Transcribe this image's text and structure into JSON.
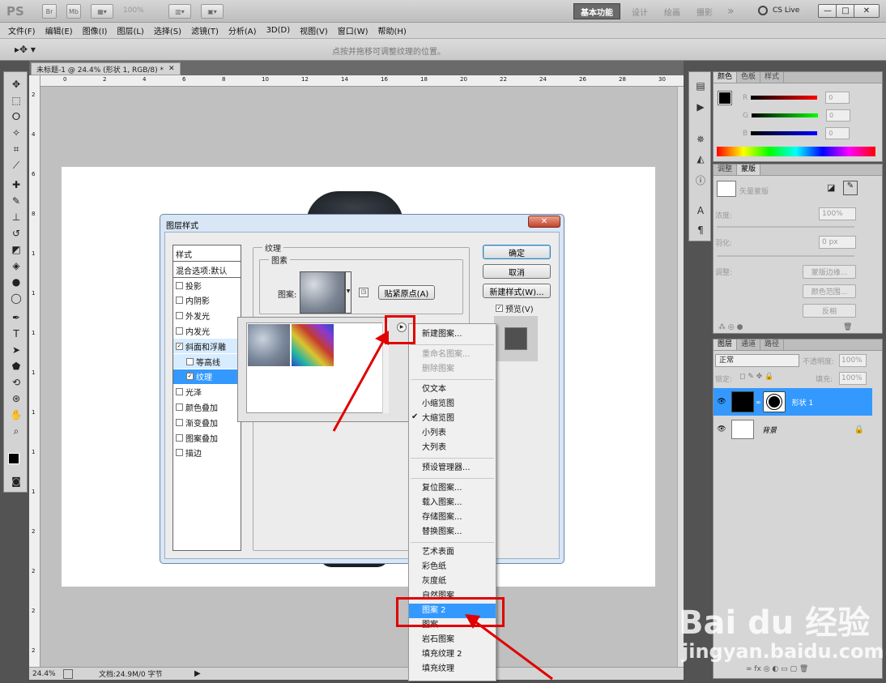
{
  "appbar": {
    "logo": "PS",
    "zoom": "100%",
    "workspaces": [
      "基本功能",
      "设计",
      "绘画",
      "摄影"
    ],
    "more": "»",
    "cslive": "CS Live",
    "min": "—",
    "restore": "□",
    "close": "✕"
  },
  "menubar": {
    "items": [
      "文件(F)",
      "编辑(E)",
      "图像(I)",
      "图层(L)",
      "选择(S)",
      "滤镜(T)",
      "分析(A)",
      "3D(D)",
      "视图(V)",
      "窗口(W)",
      "帮助(H)"
    ]
  },
  "optionsbar": {
    "hint": "点按并拖移可调整纹理的位置。"
  },
  "document": {
    "tab_title": "未标题-1 @ 24.4% (形状 1, RGB/8) *",
    "tab_close": "✕",
    "ruler_h": [
      "0",
      "2",
      "4",
      "6",
      "8",
      "10",
      "12",
      "14",
      "16",
      "18",
      "20",
      "22",
      "24",
      "26",
      "28",
      "30"
    ],
    "ruler_v": [
      "2",
      "4",
      "6",
      "8",
      "1",
      "1",
      "1",
      "1",
      "1",
      "1",
      "1",
      "2",
      "2",
      "2",
      "2"
    ]
  },
  "statusbar": {
    "zoom": "24.4%",
    "doc": "文档:24.9M/0 字节"
  },
  "color_panel": {
    "tabs": [
      "颜色",
      "色板",
      "样式"
    ],
    "labels": [
      "R",
      "G",
      "B"
    ],
    "values": [
      "0",
      "0",
      "0"
    ]
  },
  "mask_panel": {
    "tabs": [
      "调整",
      "蒙版"
    ],
    "title": "矢量蒙版",
    "density_label": "浓度:",
    "density": "100%",
    "feather_label": "羽化:",
    "feather": "0 px",
    "refine_label": "调整:",
    "buttons": [
      "蒙版边缘...",
      "颜色范围...",
      "反相"
    ]
  },
  "layers_panel": {
    "tabs": [
      "图层",
      "通道",
      "路径"
    ],
    "blend_mode": "正常",
    "opacity_label": "不透明度:",
    "opacity": "100%",
    "lock_label": "锁定:",
    "fill_label": "填充:",
    "fill": "100%",
    "layers": [
      {
        "name": "形状 1",
        "selected": true
      },
      {
        "name": "背景",
        "selected": false
      }
    ]
  },
  "dialog": {
    "title": "图层样式",
    "close": "✕",
    "styles_header": "样式",
    "blend_default": "混合选项:默认",
    "style_items": [
      {
        "label": "投影",
        "checked": false,
        "indent": false,
        "selected": false
      },
      {
        "label": "内阴影",
        "checked": false,
        "indent": false,
        "selected": false
      },
      {
        "label": "外发光",
        "checked": false,
        "indent": false,
        "selected": false
      },
      {
        "label": "内发光",
        "checked": false,
        "indent": false,
        "selected": false
      },
      {
        "label": "斜面和浮雕",
        "checked": true,
        "indent": false,
        "selected": false
      },
      {
        "label": "等高线",
        "checked": false,
        "indent": true,
        "selected": false
      },
      {
        "label": "纹理",
        "checked": true,
        "indent": true,
        "selected": true
      },
      {
        "label": "光泽",
        "checked": false,
        "indent": false,
        "selected": false
      },
      {
        "label": "颜色叠加",
        "checked": false,
        "indent": false,
        "selected": false
      },
      {
        "label": "渐变叠加",
        "checked": false,
        "indent": false,
        "selected": false
      },
      {
        "label": "图案叠加",
        "checked": false,
        "indent": false,
        "selected": false
      },
      {
        "label": "描边",
        "checked": false,
        "indent": false,
        "selected": false
      }
    ],
    "texture_group": "纹理",
    "elements_group": "图素",
    "pattern_label": "图案:",
    "snap_button": "贴紧原点(A)",
    "ok": "确定",
    "cancel": "取消",
    "new_style": "新建样式(W)...",
    "preview_label": "预览(V)",
    "preview_checked": true
  },
  "context_menu": {
    "groups": [
      [
        {
          "label": "新建图案...",
          "disabled": false
        }
      ],
      [
        {
          "label": "重命名图案...",
          "disabled": true
        },
        {
          "label": "删除图案",
          "disabled": true
        }
      ],
      [
        {
          "label": "仅文本",
          "disabled": false
        },
        {
          "label": "小缩览图",
          "disabled": false
        },
        {
          "label": "大缩览图",
          "disabled": false,
          "checked": true
        },
        {
          "label": "小列表",
          "disabled": false
        },
        {
          "label": "大列表",
          "disabled": false
        }
      ],
      [
        {
          "label": "预设管理器...",
          "disabled": false
        }
      ],
      [
        {
          "label": "复位图案...",
          "disabled": false
        },
        {
          "label": "载入图案...",
          "disabled": false
        },
        {
          "label": "存储图案...",
          "disabled": false
        },
        {
          "label": "替换图案...",
          "disabled": false
        }
      ],
      [
        {
          "label": "艺术表面",
          "disabled": false
        },
        {
          "label": "彩色纸",
          "disabled": false
        },
        {
          "label": "灰度纸",
          "disabled": false
        },
        {
          "label": "自然图案",
          "disabled": false
        },
        {
          "label": "图案 2",
          "disabled": false,
          "highlighted": true
        },
        {
          "label": "图案",
          "disabled": false
        },
        {
          "label": "岩石图案",
          "disabled": false
        },
        {
          "label": "填充纹理 2",
          "disabled": false
        },
        {
          "label": "填充纹理",
          "disabled": false
        }
      ]
    ]
  },
  "watermark": {
    "brand": "Bai du 经验",
    "url": "jingyan.baidu.com"
  },
  "colors": {
    "accent": "#3399ff",
    "annotation": "#e00000"
  }
}
